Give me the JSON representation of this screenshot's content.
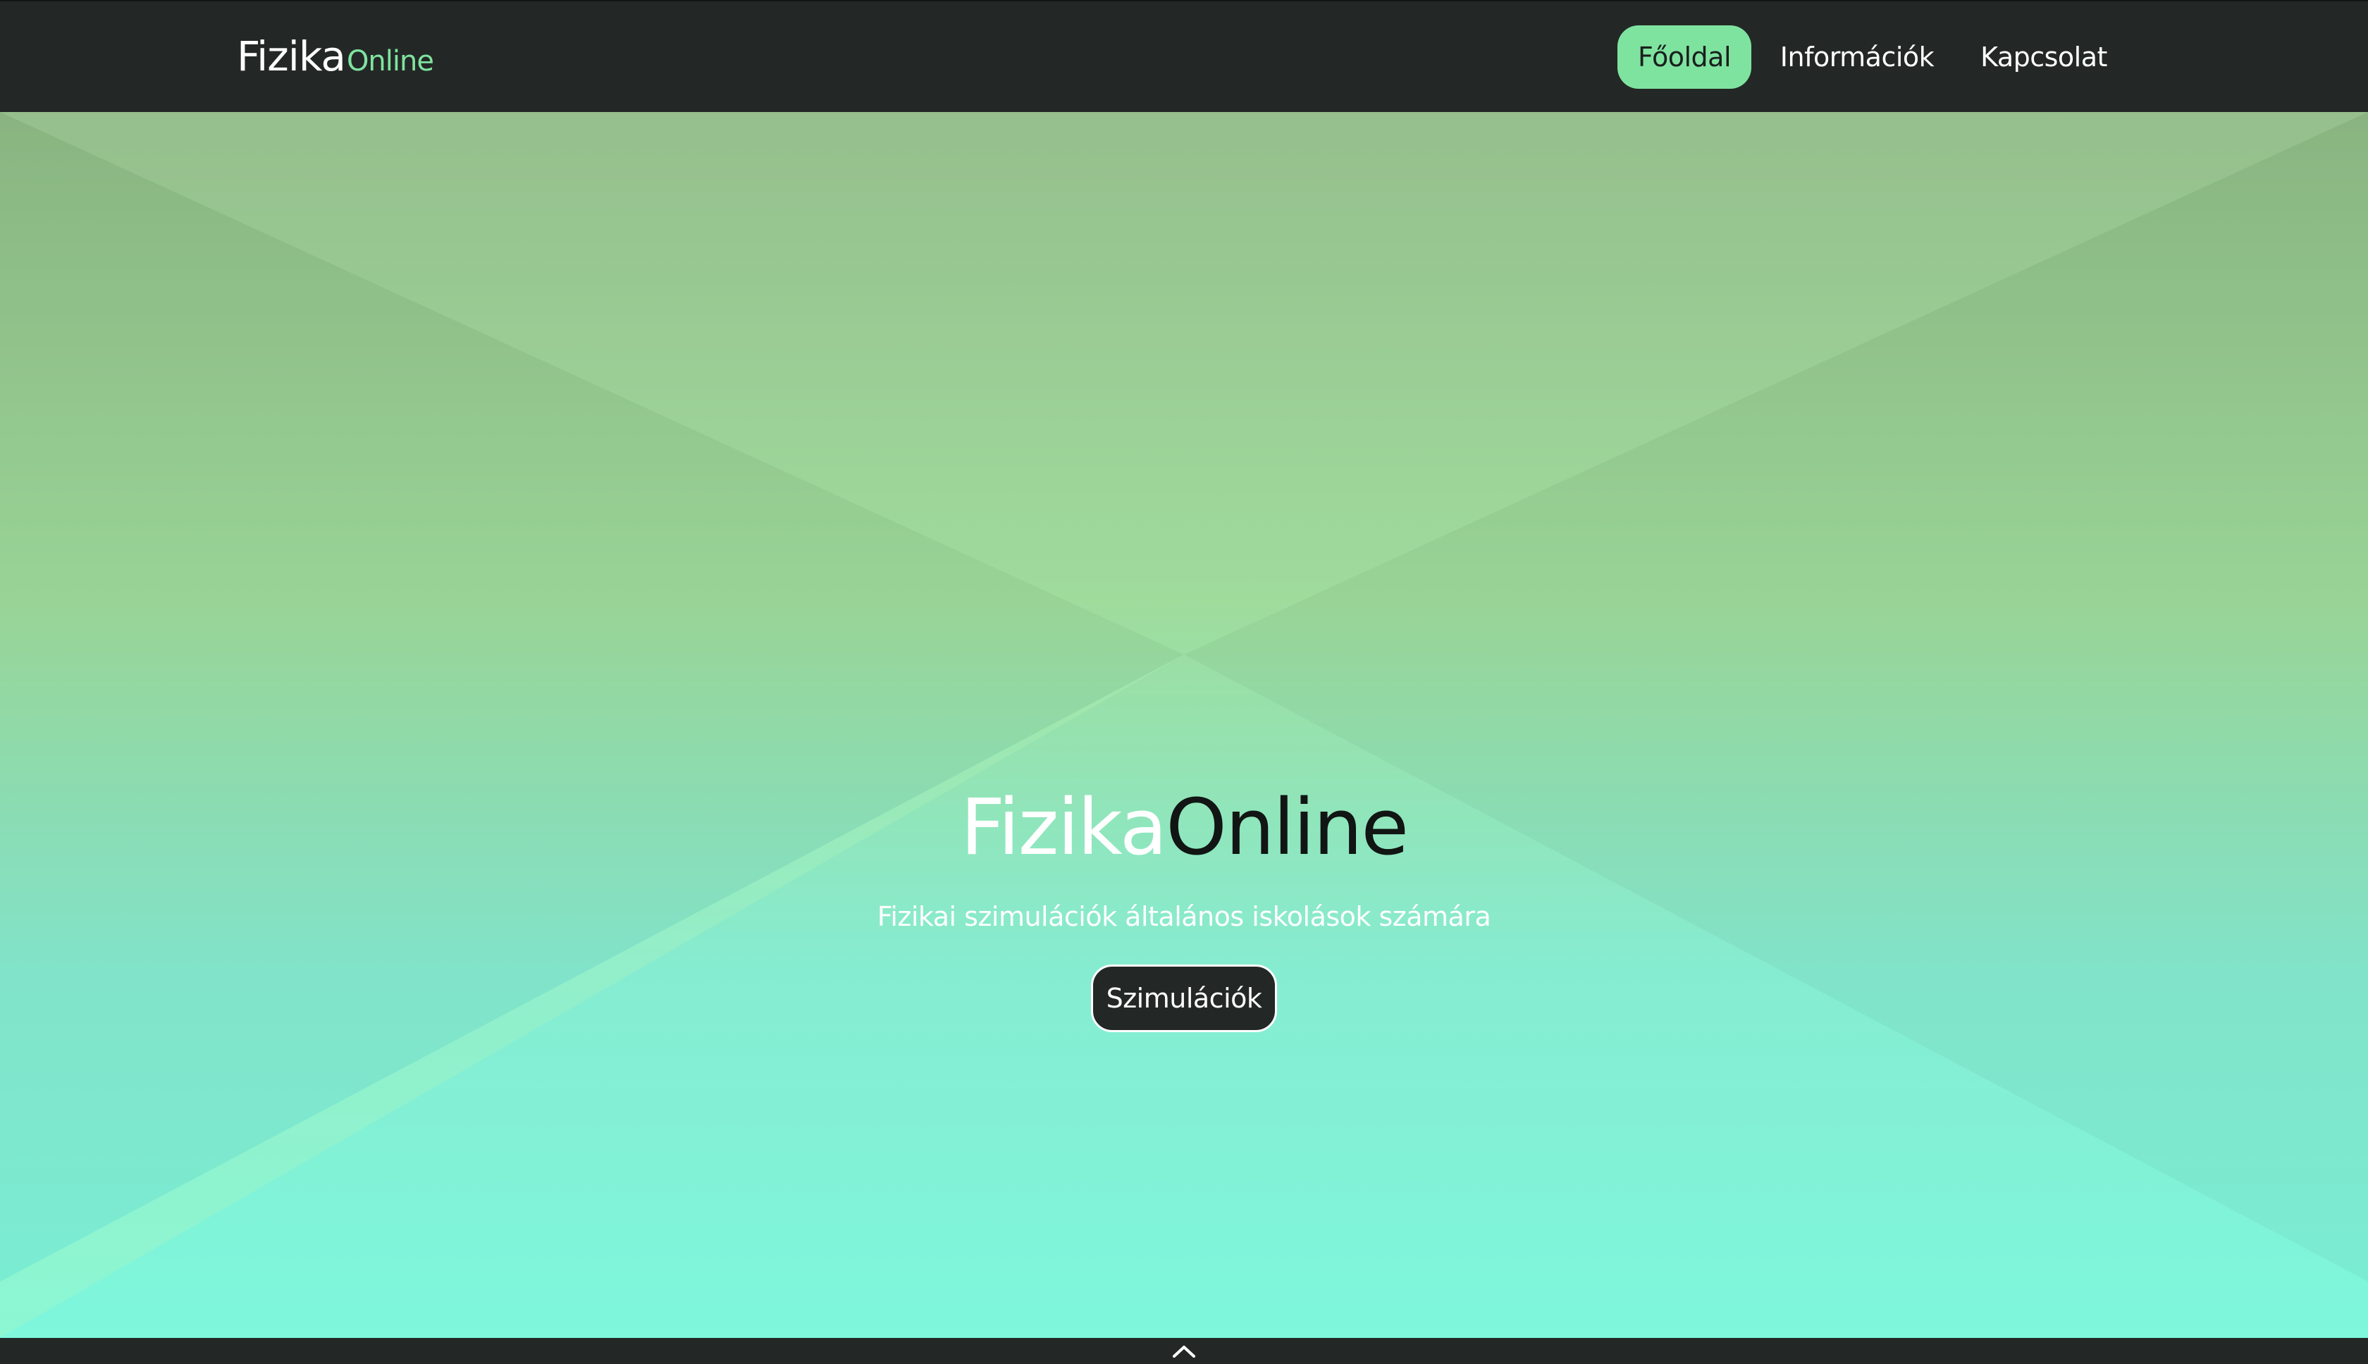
{
  "navbar": {
    "brand_main": "Fizika",
    "brand_accent": "Online",
    "items": [
      {
        "label": "Főoldal",
        "active": true
      },
      {
        "label": "Információk",
        "active": false
      },
      {
        "label": "Kapcsolat",
        "active": false
      }
    ]
  },
  "hero": {
    "title_part1": "Fizika",
    "title_part2": "Online",
    "subtitle": "Fizikai szimulációk általános iskolások számára",
    "button_label": "Szimulációk"
  },
  "bottom_bar": {
    "scroll_icon": "chevron-up-icon"
  },
  "colors": {
    "navbar_bg": "#232826",
    "accent": "#7fe3a0",
    "hero_top": "#8fbb86",
    "hero_bottom": "#7ef7dc"
  }
}
